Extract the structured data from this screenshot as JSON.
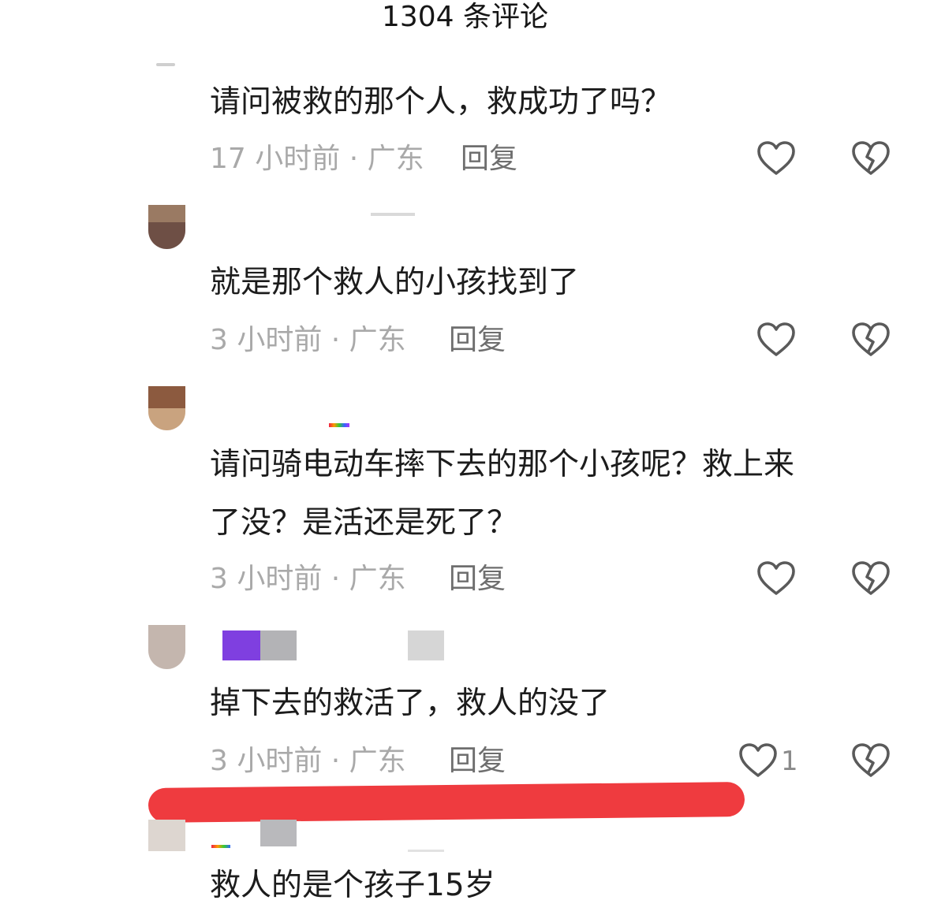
{
  "header": {
    "title": "1304 条评论"
  },
  "comments": [
    {
      "text_lines": [
        "请问被救的那个人，救成功了吗？"
      ],
      "meta": "17 小时前 · 广东",
      "reply_label": "回复",
      "like_count": ""
    },
    {
      "text_lines": [
        "就是那个救人的小孩找到了"
      ],
      "meta": "3 小时前 · 广东",
      "reply_label": "回复",
      "like_count": ""
    },
    {
      "text_lines": [
        "请问骑电动车摔下去的那个小孩呢？救上来",
        "了没？是活还是死了？"
      ],
      "meta": "3 小时前 · 广东",
      "reply_label": "回复",
      "like_count": ""
    },
    {
      "text_lines": [
        "掉下去的救活了，救人的没了"
      ],
      "meta": "3 小时前 · 广东",
      "reply_label": "回复",
      "like_count": "1"
    },
    {
      "text_lines": [
        "救人的是个孩子15岁"
      ],
      "meta": "",
      "reply_label": "",
      "like_count": ""
    }
  ],
  "icons": {
    "like": "heart-outline-icon",
    "dislike": "broken-heart-icon"
  },
  "colors": {
    "annotation_stroke": "#ef3b3f",
    "meta_text": "#a9a9a9",
    "reply_text": "#6e6e6e"
  }
}
